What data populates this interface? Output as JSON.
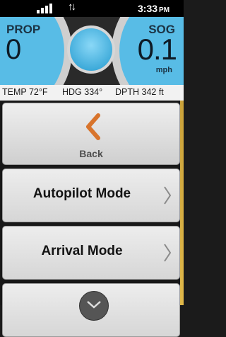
{
  "status_bar": {
    "time": "3:33",
    "ampm": "PM",
    "icons": [
      "signal-strength-icon",
      "data-sync-icon"
    ]
  },
  "gauges": {
    "prop": {
      "label": "PROP",
      "value": "0"
    },
    "sog": {
      "label": "SOG",
      "value": "0.1",
      "unit": "mph"
    }
  },
  "readout": {
    "temp": "TEMP 72°F",
    "heading": "HDG 334°",
    "depth": "DPTH  342 ft"
  },
  "menu": {
    "back_label": "Back",
    "items": [
      {
        "label": "Autopilot Mode"
      },
      {
        "label": "Arrival Mode"
      }
    ]
  },
  "colors": {
    "gauge_blue": "#5fc0ea",
    "back_arrow": "#d8742c",
    "menu_bg": "#dedede"
  }
}
